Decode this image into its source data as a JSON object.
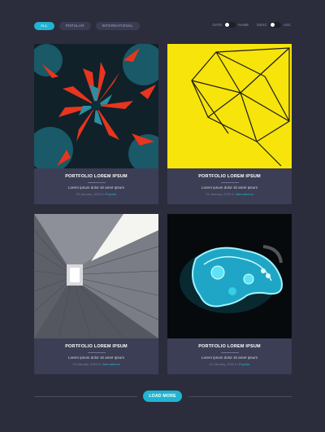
{
  "filters": [
    "All",
    "Popular",
    "International"
  ],
  "active_filter": "All",
  "sorts": [
    {
      "left": "Date",
      "right": "Name"
    },
    {
      "left": "Desc",
      "right": "Asc"
    }
  ],
  "cards": [
    {
      "title": "Portfolio Lorem Ipsum",
      "desc": "Lorem ipsum dolor sit amet Ipsum",
      "date": "23 January, 2020 In",
      "category": "Popular",
      "image": "succulent-photo"
    },
    {
      "title": "Portfolio Lorem Ipsum",
      "desc": "Lorem ipsum dolor sit amet Ipsum",
      "date": "23 January, 2020 In",
      "category": "International",
      "image": "geometric-wire-photo"
    },
    {
      "title": "Portfolio Lorem Ipsum",
      "desc": "Lorem ipsum dolor sit amet Ipsum",
      "date": "23 January, 2020 In",
      "category": "International",
      "image": "wooden-corridor-photo"
    },
    {
      "title": "Portfolio Lorem Ipsum",
      "desc": "Lorem ipsum dolor sit amet Ipsum",
      "date": "23 January, 2020 In",
      "category": "Popular",
      "image": "neon-gamepad-photo"
    }
  ],
  "load_more_label": "Load More",
  "colors": {
    "background": "#2b2d3d",
    "card": "#3b3e54",
    "accent": "#1fb5d2"
  }
}
